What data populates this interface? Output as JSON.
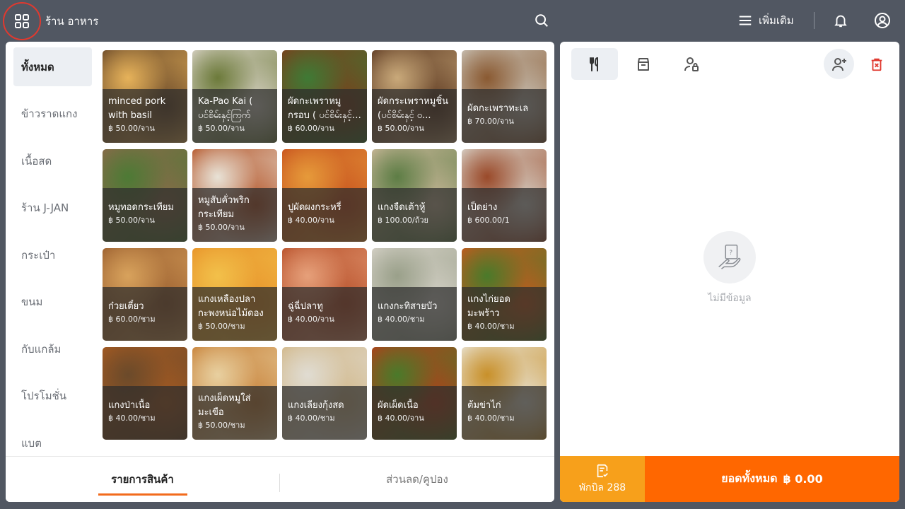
{
  "topbar": {
    "store_name": "ร้าน อาหาร",
    "more_label": "เพิ่มเติม"
  },
  "categories": [
    {
      "label": "ทั้งหมด",
      "active": true
    },
    {
      "label": "ข้าวราดแกง"
    },
    {
      "label": "เนื้อสด"
    },
    {
      "label": "ร้าน J-JAN"
    },
    {
      "label": "กระเป๋า"
    },
    {
      "label": "ขนม"
    },
    {
      "label": "กับแกล้ม"
    },
    {
      "label": "โปรโมชั่น"
    },
    {
      "label": "แบต"
    }
  ],
  "products": [
    {
      "name": "minced pork with basil",
      "price": "฿ 50.00/จาน",
      "c1": "#6b4a2a",
      "c2": "#e6b25a"
    },
    {
      "name": "Ka-Pao Kai ( ပင်စိမ်းနှင့်ကြက်",
      "price": "฿ 50.00/จาน",
      "c1": "#d8d2c5",
      "c2": "#6c7a3a"
    },
    {
      "name": "ผัดกะเพราหมูกรอบ ( ပင်စိမ်းနှင့် ...",
      "price": "฿ 60.00/จาน",
      "c1": "#7a3f1c",
      "c2": "#3f7a35"
    },
    {
      "name": "ผัดกระเพราหมูชิ้น (ပင်စိမ်းနှင့် ဝ...",
      "price": "฿ 50.00/จาน",
      "c1": "#5e3a22",
      "c2": "#c9a97a"
    },
    {
      "name": "ผัดกะเพราทะเล",
      "price": "฿ 70.00/จาน",
      "c1": "#c9c2b6",
      "c2": "#8a5a32"
    },
    {
      "name": "หมูทอดกระเทียม",
      "price": "฿ 50.00/จาน",
      "c1": "#8a6a4a",
      "c2": "#4d7a35"
    },
    {
      "name": "หมูสับคั่วพริกกระเทียม",
      "price": "฿ 50.00/จาน",
      "c1": "#b5562a",
      "c2": "#e8e2d6"
    },
    {
      "name": "ปูผัดผงกระหรี่",
      "price": "฿ 40.00/จาน",
      "c1": "#c8521e",
      "c2": "#e69a3a"
    },
    {
      "name": "แกงจืดเต้าหู้",
      "price": "฿ 100.00/ถ้วย",
      "c1": "#cbb89a",
      "c2": "#5d7d45"
    },
    {
      "name": "เป็ดย่าง",
      "price": "฿ 600.00/1",
      "c1": "#d9d4ca",
      "c2": "#9a4a2a"
    },
    {
      "name": "ก๋วยเตี๋ยว",
      "price": "฿ 60.00/ชาม",
      "c1": "#9c6030",
      "c2": "#d8a25c"
    },
    {
      "name": "แกงเหลืองปลากะพงหน่อไม้ดอง",
      "price": "฿ 50.00/ชาม",
      "c1": "#e8932a",
      "c2": "#f2c04a"
    },
    {
      "name": "ฉู่ฉี่ปลาทู",
      "price": "฿ 40.00/จาน",
      "c1": "#b8502a",
      "c2": "#e6a07a"
    },
    {
      "name": "แกงกะทิสายบัว",
      "price": "฿ 40.00/ชาม",
      "c1": "#d6d2c8",
      "c2": "#9aa08a"
    },
    {
      "name": "แกงไก่ยอดมะพร้าว",
      "price": "฿ 40.00/ชาม",
      "c1": "#c65a1e",
      "c2": "#4a7a2a"
    },
    {
      "name": "แกงป่าเนื้อ",
      "price": "฿ 40.00/ชาม",
      "c1": "#a55a22",
      "c2": "#6b4a2a"
    },
    {
      "name": "แกงเผ็ดหมูใส่มะเขือ",
      "price": "฿ 50.00/ชาม",
      "c1": "#c8823a",
      "c2": "#e8d0a0"
    },
    {
      "name": "แกงเลียงกุ้งสด",
      "price": "฿ 40.00/ชาม",
      "c1": "#d2b88a",
      "c2": "#e0dcd2"
    },
    {
      "name": "ผัดเผ็ดเนื้อ",
      "price": "฿ 40.00/จาน",
      "c1": "#b0401a",
      "c2": "#4a7a2a"
    },
    {
      "name": "ต้มข่าไก่",
      "price": "฿ 40.00/ชาม",
      "c1": "#e8e2d2",
      "c2": "#c8902a"
    }
  ],
  "bottom_tabs": {
    "products": "รายการสินค้า",
    "discounts": "ส่วนลด/คูปอง"
  },
  "order": {
    "empty_text": "ไม่มีข้อมูล",
    "hold_label": "พักบิล 288",
    "total_label": "ยอดทั้งหมด",
    "total_value": "฿ 0.00"
  },
  "colors": {
    "accent": "#ff6700",
    "hold": "#f7a01b",
    "topbar": "#515762"
  }
}
